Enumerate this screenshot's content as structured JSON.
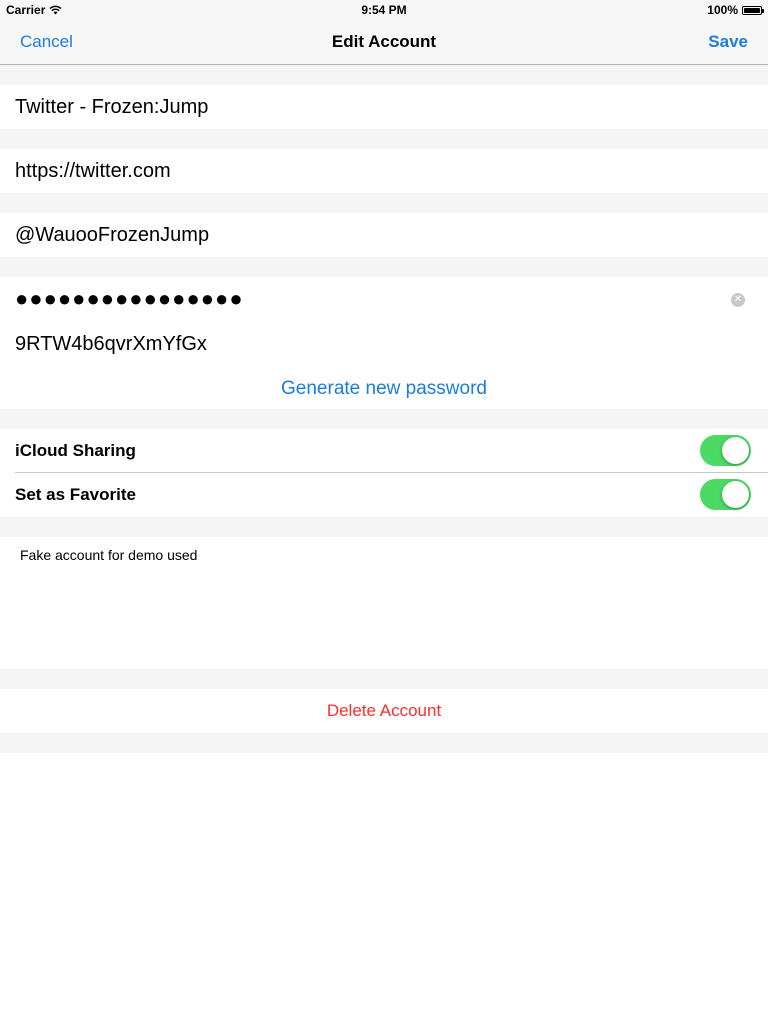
{
  "status_bar": {
    "carrier": "Carrier",
    "time": "9:54 PM",
    "battery_percent": "100%",
    "battery_level": 1.0
  },
  "nav": {
    "cancel_label": "Cancel",
    "title": "Edit Account",
    "save_label": "Save"
  },
  "account": {
    "name": "Twitter - Frozen:Jump",
    "url": "https://twitter.com",
    "username": "@WauooFrozenJump",
    "password_masked": "●●●●●●●●●●●●●●●●",
    "password_plain": "9RTW4b6qvrXmYfGx",
    "generate_label": "Generate new password"
  },
  "settings": {
    "icloud_label": "iCloud Sharing",
    "icloud_on": true,
    "favorite_label": "Set as Favorite",
    "favorite_on": true
  },
  "notes": {
    "text": "Fake account for demo used"
  },
  "delete_label": "Delete Account",
  "colors": {
    "tint": "#1a7ee0",
    "switch_on": "#4cd964",
    "destructive": "#ff2d2d",
    "group_background": "#f5f5f5"
  },
  "icons": {
    "wifi": "wifi-icon",
    "battery": "battery-icon",
    "clear": "clear-icon"
  }
}
